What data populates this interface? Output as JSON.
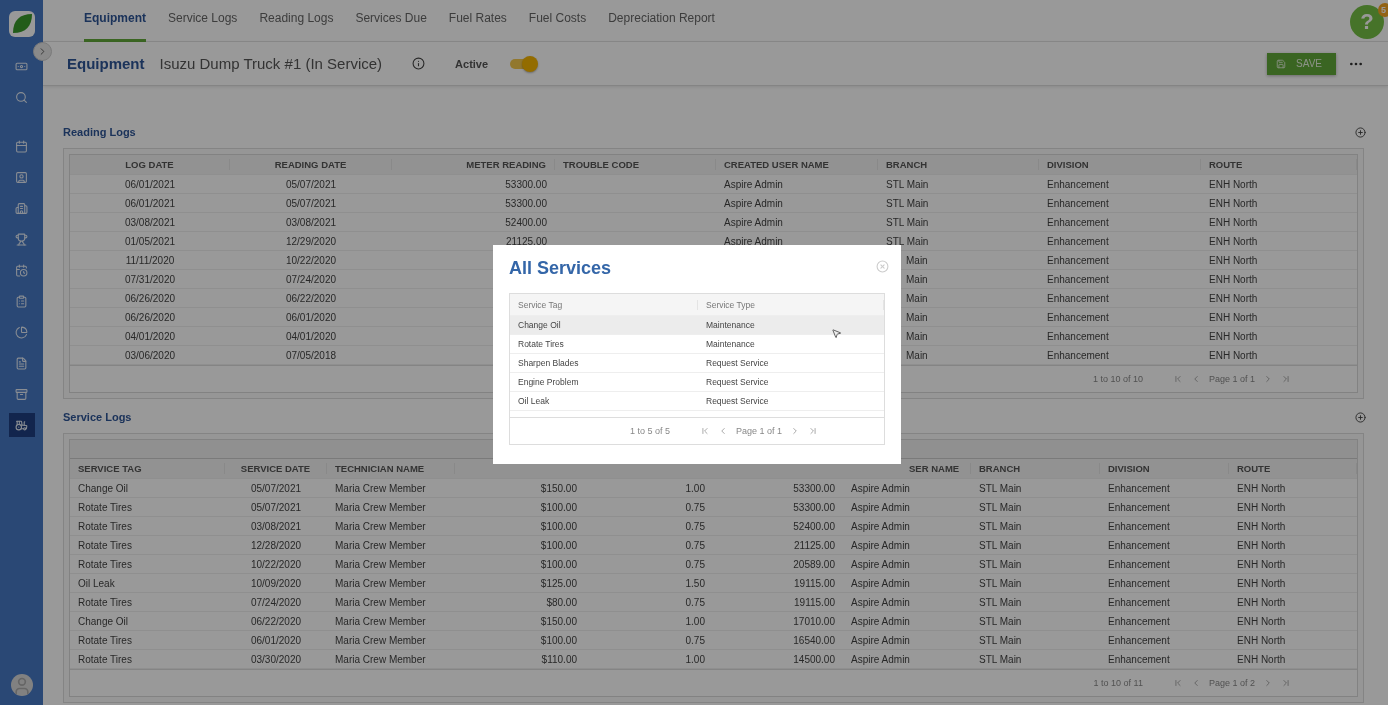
{
  "sidebar": {
    "items": [
      {
        "selected": false
      },
      {
        "selected": false
      },
      {
        "selected": false
      },
      {
        "selected": false
      },
      {
        "selected": false
      },
      {
        "selected": false
      },
      {
        "selected": false
      },
      {
        "selected": false
      },
      {
        "selected": false
      },
      {
        "selected": false
      },
      {
        "selected": false
      },
      {
        "selected": true
      }
    ]
  },
  "tabs": [
    {
      "label": "Equipment",
      "selected": true
    },
    {
      "label": "Service Logs",
      "selected": false
    },
    {
      "label": "Reading Logs",
      "selected": false
    },
    {
      "label": "Services Due",
      "selected": false
    },
    {
      "label": "Fuel Rates",
      "selected": false
    },
    {
      "label": "Fuel Costs",
      "selected": false
    },
    {
      "label": "Depreciation Report",
      "selected": false
    }
  ],
  "help": {
    "label": "?",
    "badge": "5"
  },
  "header": {
    "section": "Equipment",
    "title": "Isuzu Dump Truck #1 (In Service)",
    "status_label": "Active",
    "active_on": true,
    "save_label": "SAVE"
  },
  "reading_logs": {
    "title": "Reading Logs",
    "columns": [
      "LOG DATE",
      "READING DATE",
      "METER READING",
      "TROUBLE CODE",
      "CREATED USER NAME",
      "BRANCH",
      "DIVISION",
      "ROUTE"
    ],
    "rows": [
      {
        "log_date": "06/01/2021",
        "reading_date": "05/07/2021",
        "meter_reading": "53300.00",
        "created_user_name": "Aspire Admin",
        "branch": "STL Main",
        "division": "Enhancement",
        "route": "ENH North"
      },
      {
        "log_date": "06/01/2021",
        "reading_date": "05/07/2021",
        "meter_reading": "53300.00",
        "created_user_name": "Aspire Admin",
        "branch": "STL Main",
        "division": "Enhancement",
        "route": "ENH North"
      },
      {
        "log_date": "03/08/2021",
        "reading_date": "03/08/2021",
        "meter_reading": "52400.00",
        "created_user_name": "Aspire Admin",
        "branch": "STL Main",
        "division": "Enhancement",
        "route": "ENH North"
      },
      {
        "log_date": "01/05/2021",
        "reading_date": "12/29/2020",
        "meter_reading": "21125.00",
        "created_user_name": "Aspire Admin",
        "branch": "STL Main",
        "division": "Enhancement",
        "route": "ENH North"
      },
      {
        "log_date": "11/11/2020",
        "reading_date": "10/22/2020",
        "branch": "Main",
        "division": "Enhancement",
        "route": "ENH North"
      },
      {
        "log_date": "07/31/2020",
        "reading_date": "07/24/2020",
        "branch": "Main",
        "division": "Enhancement",
        "route": "ENH North"
      },
      {
        "log_date": "06/26/2020",
        "reading_date": "06/22/2020",
        "branch": "Main",
        "division": "Enhancement",
        "route": "ENH North"
      },
      {
        "log_date": "06/26/2020",
        "reading_date": "06/01/2020",
        "branch": "Main",
        "division": "Enhancement",
        "route": "ENH North"
      },
      {
        "log_date": "04/01/2020",
        "reading_date": "04/01/2020",
        "branch": "Main",
        "division": "Enhancement",
        "route": "ENH North"
      },
      {
        "log_date": "03/06/2020",
        "reading_date": "07/05/2018",
        "branch": "Main",
        "division": "Enhancement",
        "route": "ENH North"
      }
    ],
    "pager": {
      "range": "1 to 10 of 10",
      "page": "Page 1 of 1"
    }
  },
  "service_logs": {
    "title": "Service Logs",
    "columns": [
      "SERVICE TAG",
      "SERVICE DATE",
      "TECHNICIAN NAME",
      "SER NAME",
      "BRANCH",
      "DIVISION",
      "ROUTE"
    ],
    "rows": [
      {
        "service_tag": "Change Oil",
        "service_date": "05/07/2021",
        "technician_name": "Maria Crew Member",
        "column_4": "$150.00",
        "column_5": "1.00",
        "column_6": "53300.00",
        "created_user_name": "Aspire Admin",
        "branch": "STL Main",
        "division": "Enhancement",
        "route": "ENH North"
      },
      {
        "service_tag": "Rotate Tires",
        "service_date": "05/07/2021",
        "technician_name": "Maria Crew Member",
        "column_4": "$100.00",
        "column_5": "0.75",
        "column_6": "53300.00",
        "created_user_name": "Aspire Admin",
        "branch": "STL Main",
        "division": "Enhancement",
        "route": "ENH North"
      },
      {
        "service_tag": "Rotate Tires",
        "service_date": "03/08/2021",
        "technician_name": "Maria Crew Member",
        "column_4": "$100.00",
        "column_5": "0.75",
        "column_6": "52400.00",
        "created_user_name": "Aspire Admin",
        "branch": "STL Main",
        "division": "Enhancement",
        "route": "ENH North"
      },
      {
        "service_tag": "Rotate Tires",
        "service_date": "12/28/2020",
        "technician_name": "Maria Crew Member",
        "column_4": "$100.00",
        "column_5": "0.75",
        "column_6": "21125.00",
        "created_user_name": "Aspire Admin",
        "branch": "STL Main",
        "division": "Enhancement",
        "route": "ENH North"
      },
      {
        "service_tag": "Rotate Tires",
        "service_date": "10/22/2020",
        "technician_name": "Maria Crew Member",
        "column_4": "$100.00",
        "column_5": "0.75",
        "column_6": "20589.00",
        "created_user_name": "Aspire Admin",
        "branch": "STL Main",
        "division": "Enhancement",
        "route": "ENH North"
      },
      {
        "service_tag": "Oil Leak",
        "service_date": "10/09/2020",
        "technician_name": "Maria Crew Member",
        "column_4": "$125.00",
        "column_5": "1.50",
        "column_6": "19115.00",
        "created_user_name": "Aspire Admin",
        "branch": "STL Main",
        "division": "Enhancement",
        "route": "ENH North"
      },
      {
        "service_tag": "Rotate Tires",
        "service_date": "07/24/2020",
        "technician_name": "Maria Crew Member",
        "column_4": "$80.00",
        "column_5": "0.75",
        "column_6": "19115.00",
        "created_user_name": "Aspire Admin",
        "branch": "STL Main",
        "division": "Enhancement",
        "route": "ENH North"
      },
      {
        "service_tag": "Change Oil",
        "service_date": "06/22/2020",
        "technician_name": "Maria Crew Member",
        "column_4": "$150.00",
        "column_5": "1.00",
        "column_6": "17010.00",
        "created_user_name": "Aspire Admin",
        "branch": "STL Main",
        "division": "Enhancement",
        "route": "ENH North"
      },
      {
        "service_tag": "Rotate Tires",
        "service_date": "06/01/2020",
        "technician_name": "Maria Crew Member",
        "column_4": "$100.00",
        "column_5": "0.75",
        "column_6": "16540.00",
        "created_user_name": "Aspire Admin",
        "branch": "STL Main",
        "division": "Enhancement",
        "route": "ENH North"
      },
      {
        "service_tag": "Rotate Tires",
        "service_date": "03/30/2020",
        "technician_name": "Maria Crew Member",
        "column_4": "$110.00",
        "column_5": "1.00",
        "column_6": "14500.00",
        "created_user_name": "Aspire Admin",
        "branch": "STL Main",
        "division": "Enhancement",
        "route": "ENH North"
      }
    ],
    "pager": {
      "range": "1 to 10 of 11",
      "page": "Page 1 of 2"
    }
  },
  "modal": {
    "title": "All Services",
    "columns": [
      "Service Tag",
      "Service Type"
    ],
    "rows": [
      {
        "service_tag": "Change Oil",
        "service_type": "Maintenance",
        "selected": true
      },
      {
        "service_tag": "Rotate Tires",
        "service_type": "Maintenance",
        "selected": false
      },
      {
        "service_tag": "Sharpen Blades",
        "service_type": "Request Service",
        "selected": false
      },
      {
        "service_tag": "Engine Problem",
        "service_type": "Request Service",
        "selected": false
      },
      {
        "service_tag": "Oil Leak",
        "service_type": "Request Service",
        "selected": false
      }
    ],
    "pager": {
      "range": "1 to 5 of 5",
      "page": "Page 1 of 1"
    }
  }
}
